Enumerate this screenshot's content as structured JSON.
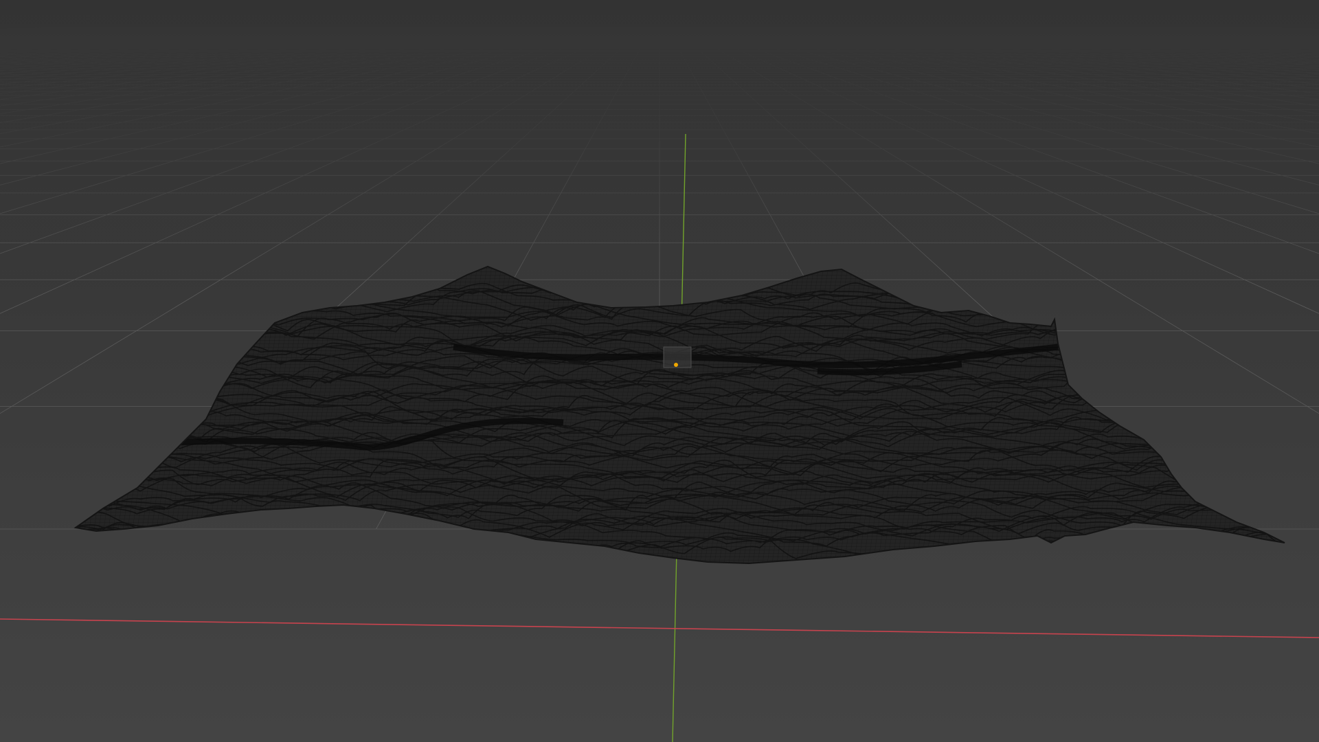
{
  "viewport": {
    "background_top": "#2f2f2f",
    "background_bottom": "#444444",
    "grid_color": "#5b5b5b",
    "x_axis_color": "#c8434e",
    "y_axis_color": "#72a42b",
    "mesh_color": "#141414",
    "mesh_fill": "#242424",
    "origin_color": "#f0a800"
  },
  "objects": [
    {
      "name": "terrain-mesh",
      "display": "wireframe"
    },
    {
      "name": "plane-object",
      "display": "wireframe"
    },
    {
      "name": "object-origin",
      "display": "point"
    }
  ]
}
